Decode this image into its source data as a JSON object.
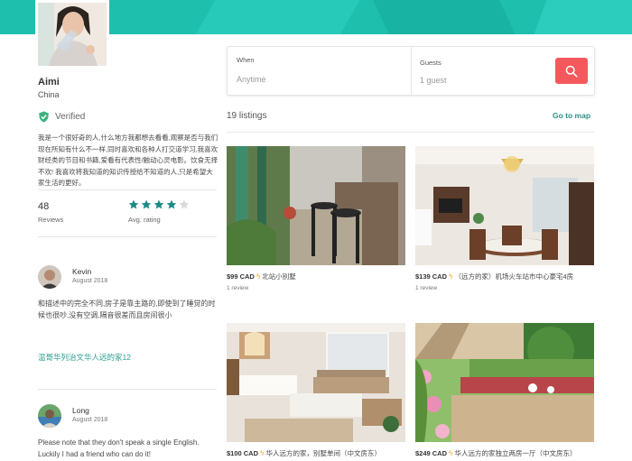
{
  "profile": {
    "name": "Aimi",
    "country": "China",
    "verified_label": "Verified",
    "bio": "我是一个很好奇的人,什么地方我都想去看看,观察是否与我们现在所知有什么不一样,同时喜欢和各种人打交道学习,我喜欢财经类的节目和书籍,爱看有代表性/触动心灵电影。饮食无择不欢! 我喜欢将我知道的知识传授给不知道的人,只是希望大家生活的更好。",
    "reviews_count": "48",
    "reviews_label": "Reviews",
    "rating": 4,
    "rating_max": 5,
    "rating_label": "Avg. rating"
  },
  "reviews": [
    {
      "name": "Kevin",
      "date": "August 2018",
      "text": "和描述中的完全不同,房子是靠主路的,即使到了睡觉的时候也很吵,没有空调,隔音很差而且房间很小",
      "link": "温哥华列治文华人远的家12"
    },
    {
      "name": "Long",
      "date": "August 2018",
      "text": "Please note that they don't speak a single English. Luckily I had a friend who can do it!"
    }
  ],
  "search": {
    "when_label": "When",
    "when_value": "Anytime",
    "guests_label": "Guests",
    "guests_value": "1 guest",
    "button_icon": "search-icon"
  },
  "listings": {
    "count_label": "19 listings",
    "map_link": "Go to map",
    "items": [
      {
        "price": "$99 CAD",
        "title": "北站小别墅",
        "reviews": "1 review"
      },
      {
        "price": "$139 CAD",
        "title": "（远方的家）机场火车站市中心豪宅4房",
        "reviews": "1 review"
      },
      {
        "price": "$100 CAD",
        "title": "华人远方的家，别墅单间（中文房东）"
      },
      {
        "price": "$249 CAD",
        "title": "华人远方的家独立两房一厅（中文房东）"
      }
    ]
  },
  "colors": {
    "banner": "#1fbfae",
    "accent": "#2aa08f",
    "search_button": "#f5585d",
    "star": "#1a8a86",
    "verified": "#3db37f"
  }
}
